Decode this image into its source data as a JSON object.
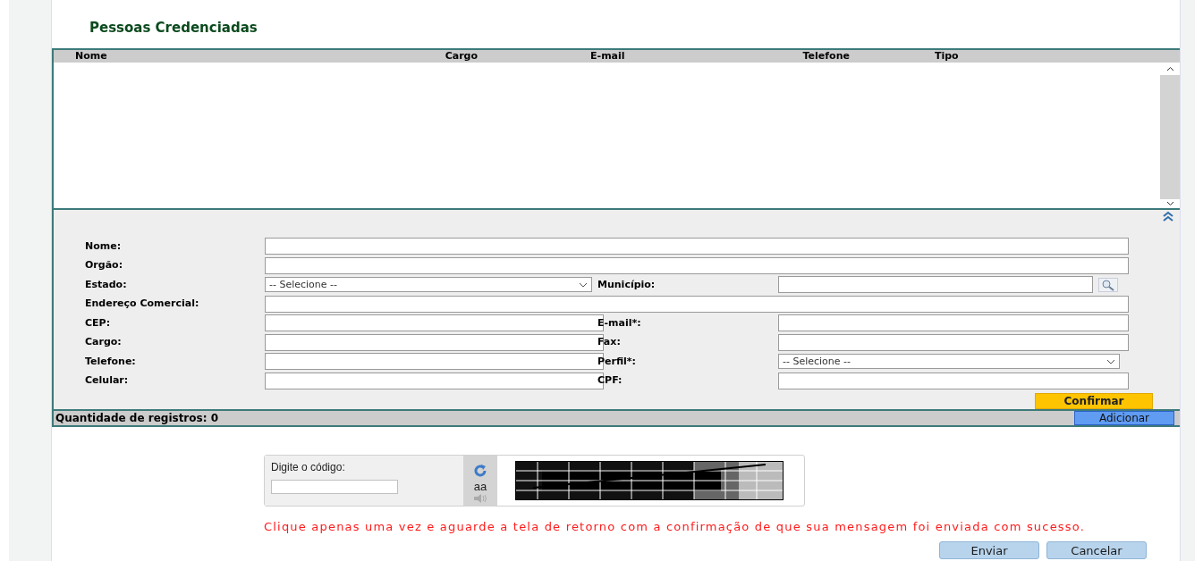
{
  "title": "Pessoas Credenciadas",
  "table": {
    "columns": [
      "Nome",
      "Cargo",
      "E-mail",
      "Telefone",
      "Tipo"
    ]
  },
  "form": {
    "rows": [
      [
        {
          "label": "Nome:",
          "kind": "text"
        }
      ],
      [
        {
          "label": "Orgão:",
          "kind": "text"
        }
      ],
      [
        {
          "label": "Estado:",
          "kind": "select",
          "value": "-- Selecione --"
        },
        {
          "label": "Município:",
          "kind": "lookup"
        }
      ],
      [
        {
          "label": "Endereço Comercial:",
          "kind": "text"
        }
      ],
      [
        {
          "label": "CEP:",
          "kind": "text"
        },
        {
          "label": "E-mail*:",
          "kind": "text"
        }
      ],
      [
        {
          "label": "Cargo:",
          "kind": "text"
        },
        {
          "label": "Fax:",
          "kind": "text"
        }
      ],
      [
        {
          "label": "Telefone:",
          "kind": "text"
        },
        {
          "label": "Perfil*:",
          "kind": "select",
          "value": "-- Selecione --"
        }
      ],
      [
        {
          "label": "Celular:",
          "kind": "text"
        },
        {
          "label": "CPF:",
          "kind": "text"
        }
      ]
    ],
    "confirm_button": "Confirmar"
  },
  "status_bar": {
    "text": "Quantidade de registros: 0",
    "add_button": "Adicionar"
  },
  "captcha": {
    "label": "Digite o código:",
    "audio_text": "aa"
  },
  "notice": "Clique apenas uma vez e aguarde a tela de retorno com a confirmação de que sua mensagem foi enviada com sucesso.",
  "buttons": [
    "Enviar",
    "Cancelar"
  ]
}
